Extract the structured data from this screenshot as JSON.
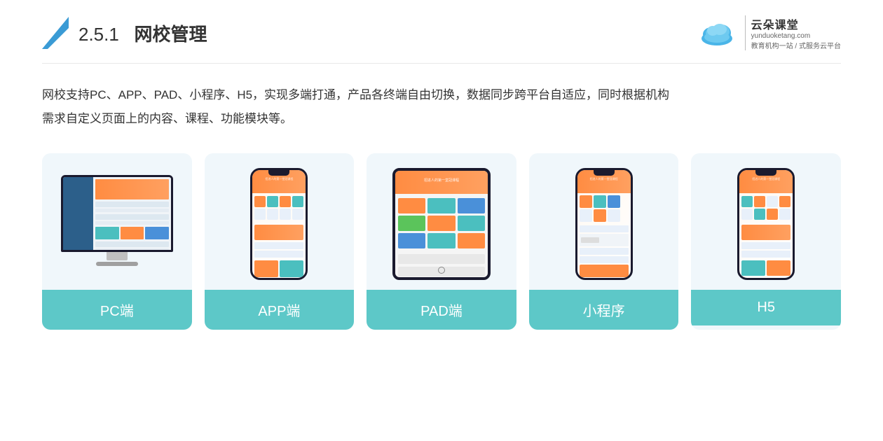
{
  "header": {
    "section_number": "2.5.1",
    "title": "网校管理",
    "brand_name_cn": "云朵课堂",
    "brand_website": "yunduoketang.com",
    "brand_tagline_1": "教育机构一站",
    "brand_tagline_2": "式服务云平台"
  },
  "description": {
    "line1": "网校支持PC、APP、PAD、小程序、H5，实现多端打通，产品各终端自由切换，数据同步跨平台自适应，同时根据机构",
    "line2": "需求自定义页面上的内容、课程、功能模块等。"
  },
  "cards": [
    {
      "id": "pc",
      "label": "PC端"
    },
    {
      "id": "app",
      "label": "APP端"
    },
    {
      "id": "pad",
      "label": "PAD端"
    },
    {
      "id": "miniprogram",
      "label": "小程序"
    },
    {
      "id": "h5",
      "label": "H5"
    }
  ],
  "colors": {
    "card_bg": "#f0f7fb",
    "card_label_bg": "#5dc8c8",
    "header_title_number_color": "#333",
    "title_bold_color": "#333",
    "accent_blue": "#3a9bd5",
    "text_dark": "#333"
  }
}
